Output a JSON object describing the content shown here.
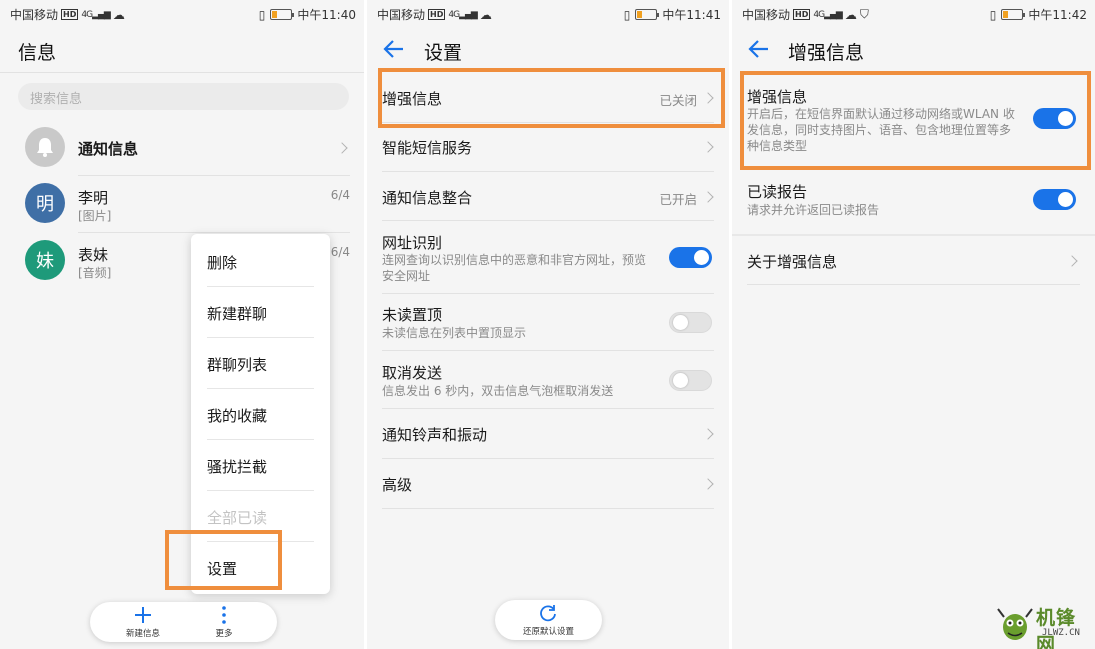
{
  "colors": {
    "accent": "#1a73e8",
    "highlight": "#ef8e3d",
    "avatar_liming": "#3f6fa6",
    "avatar_biaomei": "#1e9a7a",
    "avatar_notice": "#c9c9c9"
  },
  "screens": [
    {
      "status": {
        "carrier": "中国移动",
        "hd": "HD",
        "signal": "4G",
        "time": "中午11:40"
      },
      "title": "信息",
      "search_placeholder": "搜索信息",
      "conversations": [
        {
          "avatar_icon": "bell-icon",
          "name": "通知信息",
          "sub": "",
          "meta": ""
        },
        {
          "avatar": "明",
          "name": "李明",
          "sub": "[图片]",
          "meta": "6/4"
        },
        {
          "avatar": "妹",
          "name": "表妹",
          "sub": "[音频]",
          "meta": "6/4"
        }
      ],
      "menu": [
        "删除",
        "新建群聊",
        "群聊列表",
        "我的收藏",
        "骚扰拦截",
        "全部已读",
        "设置"
      ],
      "menu_disabled_index": 5,
      "bottom": {
        "new_label": "新建信息",
        "new_icon": "plus-icon",
        "more_label": "更多",
        "more_icon": "more-vertical-icon"
      }
    },
    {
      "status": {
        "carrier": "中国移动",
        "hd": "HD",
        "signal": "4G",
        "time": "中午11:41"
      },
      "title": "设置",
      "back_icon": "back-arrow-icon",
      "rows": [
        {
          "label": "增强信息",
          "value": "已关闭"
        },
        {
          "label": "智能短信服务"
        },
        {
          "label": "通知信息整合",
          "value": "已开启"
        },
        {
          "label": "网址识别",
          "desc": "连网查询以识别信息中的恶意和非官方网址，预览安全网址",
          "toggle": true
        },
        {
          "label": "未读置顶",
          "desc": "未读信息在列表中置顶显示",
          "toggle": false
        },
        {
          "label": "取消发送",
          "desc": "信息发出 6 秒内，双击信息气泡框取消发送",
          "toggle": false
        },
        {
          "label": "通知铃声和振动"
        },
        {
          "label": "高级"
        }
      ],
      "bottom": {
        "reset_label": "还原默认设置",
        "reset_icon": "refresh-icon"
      }
    },
    {
      "status": {
        "carrier": "中国移动",
        "hd": "HD",
        "signal": "4G",
        "time": "中午11:42"
      },
      "title": "增强信息",
      "back_icon": "back-arrow-icon",
      "rows": [
        {
          "label": "增强信息",
          "desc": "开启后，在短信界面默认通过移动网络或WLAN 收发信息，同时支持图片、语音、包含地理位置等多种信息类型",
          "toggle": true
        },
        {
          "label": "已读报告",
          "desc": "请求并允许返回已读报告",
          "toggle": true
        },
        {
          "label": "关于增强信息"
        }
      ]
    }
  ],
  "watermark": {
    "text": "机锋网",
    "url": "JLWZ.CN"
  }
}
